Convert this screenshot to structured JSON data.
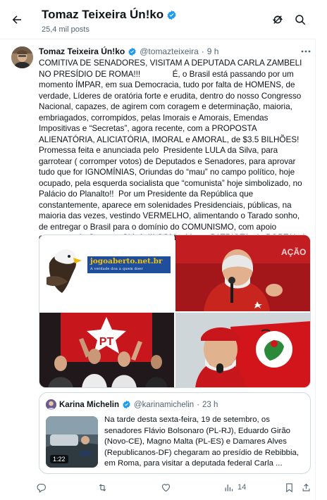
{
  "header": {
    "title": "Tomaz Teixeira Ún!ko",
    "subtitle": "25,4 mil posts"
  },
  "post": {
    "author_name": "Tomaz Teixeira Ún!ko",
    "handle": "@tomazteixeira",
    "separator": "·",
    "time": "9 h",
    "text": "COMITIVA DE SENADORES, VISITAM A DEPUTADA CARLA ZAMBELI NO PRESÍDIO DE ROMA!!!              É, o Brasil está passando por um momento ÍMPAR, em sua Democracia, tudo por falta de HOMENS, de verdade, Líderes de oratória forte e erudita, dentro do nosso Congresso Nacional, capazes, de agirem com coragem e determinação, maioria, embriagados, corrompidos, pelas Imorais e Amorais, Emendas Impositivas e “Secretas”, agora recente, com a PROPOSTA ALIENATÓRIA, ALICIATÓRIA, IMORAL e AMORAL, de $3.5 BILHÕES!  Promessa feita e anunciada pelo  Presidente LULA da Silva, para garrotear ( corromper votos) de Deputados e Senadores, para aprovar tudo que for IGNOMÍNIAS, Oriundas do “mau” no campo político, hoje ocupado, pela esquerda socialista que “comunista” hoje simbolizado, no Palácio do Planalto!!  Por um Presidente da República que constantemente, aparece em solenidades Presidenciais, públicas, na maioria das vezes, vestindo VERMELHO, alimentando o Tarado sonho, de entregar o Brasil para o domínio do COMUNISMO, com apoio constante do Governo Chinês!!! COM a Marca PATRIOTA, do PORTAL da ÁGUIA!!",
    "image1_site": "jogoaberto.net.br",
    "image1_tagline": "A verdade doa a quem doer",
    "image3_sign": "PT",
    "image2_star_text": "PT"
  },
  "quote": {
    "author_name": "Karina Michelin",
    "handle": "@karinamichelin",
    "separator": "·",
    "time": "23 h",
    "video_duration": "1:22",
    "text": "Na tarde desta sexta-feira, 19 de setembro, os senadores Flávio Bolsonaro (PL-RJ), Eduardo Girão (Novo-CE), Magno Malta (PL-ES) e Damares Alves (Republicanos-DF) chegaram ao presídio de Rebibbia, em Roma, para visitar a deputada federal Carla ..."
  },
  "actions": {
    "views_count": "14"
  },
  "colors": {
    "verified_blue": "#1d9bf0",
    "muted_text": "#536471",
    "border": "#cfd9de",
    "pt_red": "#c8161d"
  },
  "icons": [
    "back-arrow-icon",
    "verified-badge-icon",
    "refresh-icon",
    "search-icon",
    "more-icon",
    "reply-icon",
    "repost-icon",
    "like-icon",
    "views-icon",
    "bookmark-icon",
    "share-icon"
  ]
}
